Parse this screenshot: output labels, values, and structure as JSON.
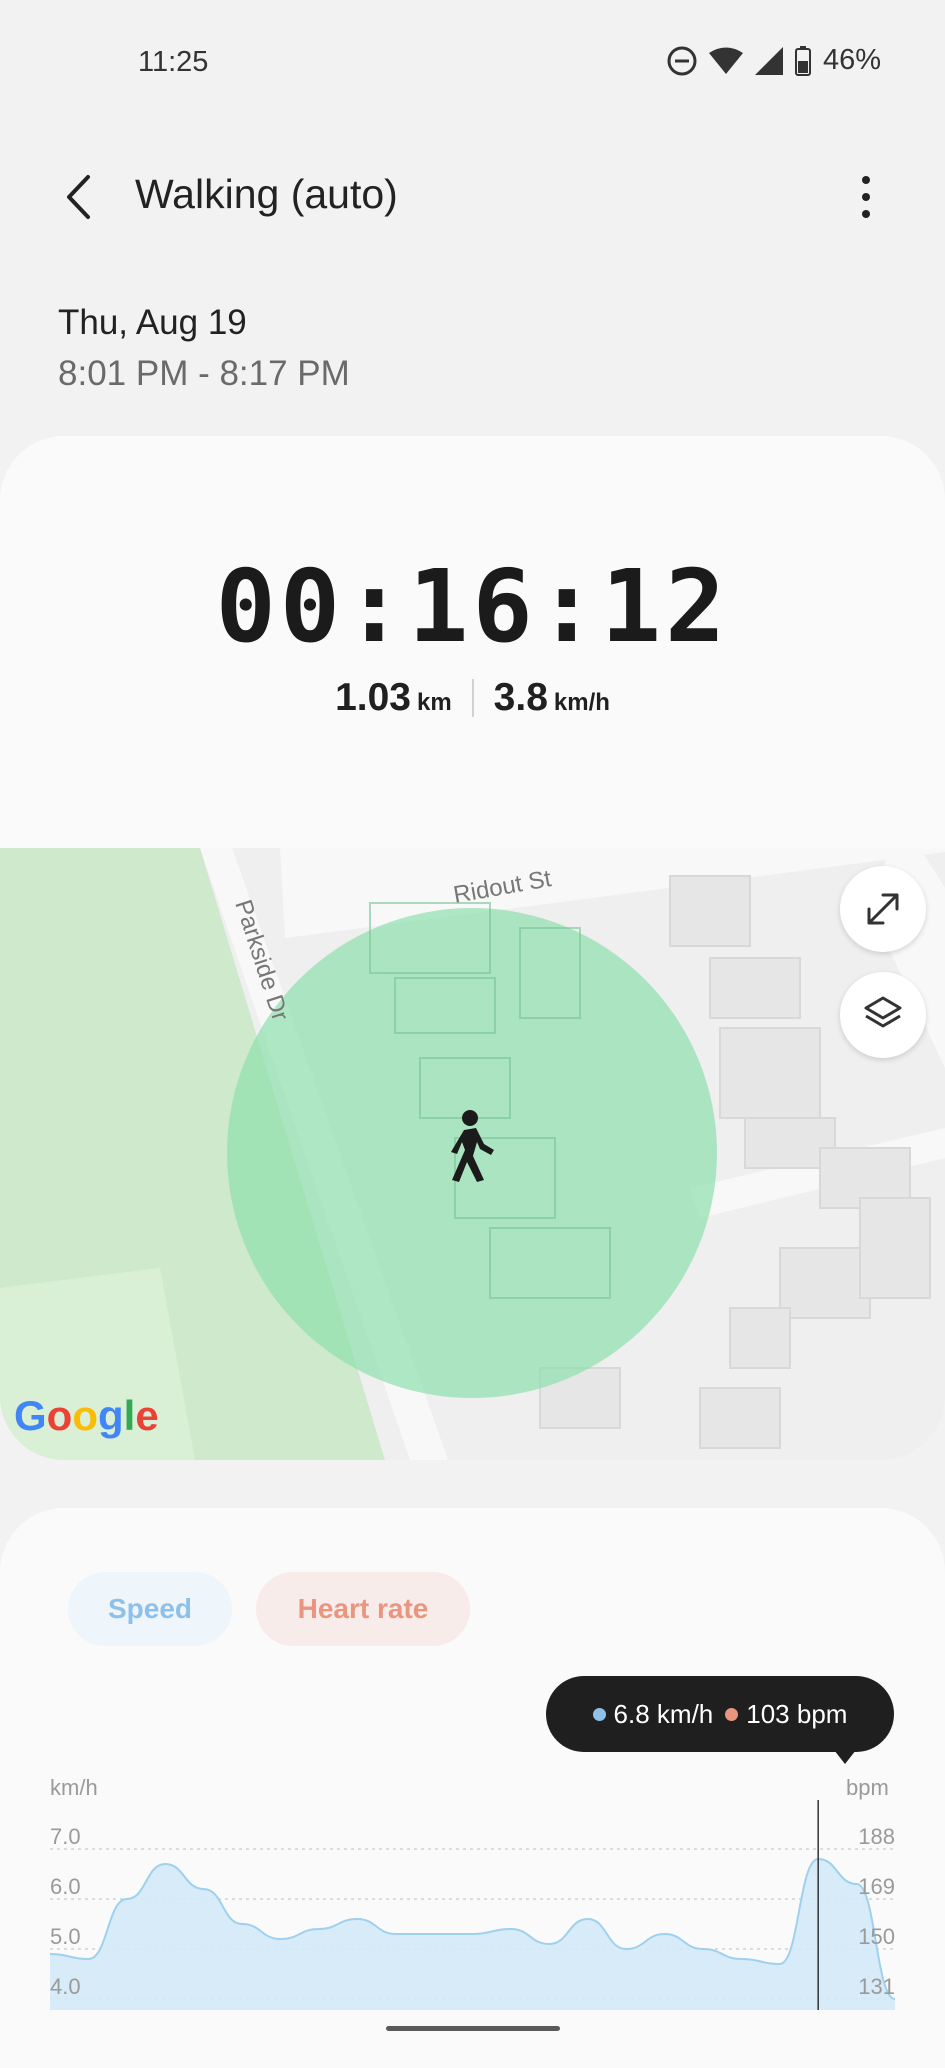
{
  "status_bar": {
    "time": "11:25",
    "battery": "46%"
  },
  "header": {
    "title": "Walking (auto)"
  },
  "session": {
    "date": "Thu, Aug 19",
    "time_range": "8:01 PM - 8:17 PM"
  },
  "summary": {
    "duration": "00:16:12",
    "distance_value": "1.03",
    "distance_unit": "km",
    "speed_value": "3.8",
    "speed_unit": "km/h"
  },
  "map": {
    "streets": {
      "ridout": "Ridout St",
      "parkside": "Parkside Dr"
    },
    "brand": "Google",
    "icons": {
      "expand": "expand-icon",
      "layers": "layers-icon",
      "walker": "walking-person-icon"
    }
  },
  "chart_tabs": {
    "speed": "Speed",
    "heart_rate": "Heart rate"
  },
  "tooltip": {
    "speed": "6.8 km/h",
    "heart_rate": "103 bpm"
  },
  "colors": {
    "speed": "#8ec1ea",
    "heart_rate": "#e9957f",
    "area_fill": "#d3e9f7",
    "area_stroke": "#9fd0ee",
    "map_green": "#8fe0ad"
  },
  "chart_data": {
    "type": "area",
    "left_axis_label": "km/h",
    "right_axis_label": "bpm",
    "left_ticks": [
      "7.0",
      "6.0",
      "5.0",
      "4.0"
    ],
    "right_ticks": [
      "188",
      "169",
      "150",
      "131"
    ],
    "ylim": [
      4.0,
      7.0
    ],
    "series": [
      {
        "name": "Speed",
        "values": [
          4.9,
          4.8,
          6.0,
          6.7,
          6.2,
          5.5,
          5.2,
          5.4,
          5.6,
          5.3,
          5.3,
          5.3,
          5.4,
          5.1,
          5.6,
          5.0,
          5.3,
          5.0,
          4.8,
          4.7,
          6.8,
          6.3,
          4.0
        ]
      }
    ],
    "selected_index": 20
  }
}
